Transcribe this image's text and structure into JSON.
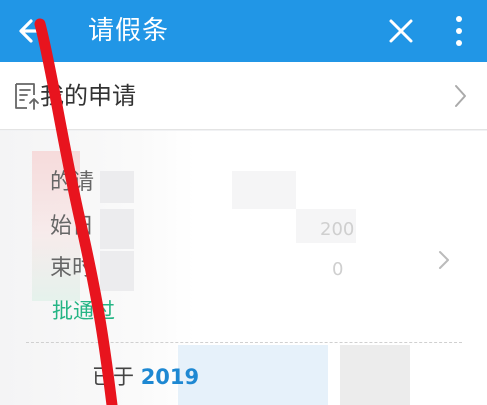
{
  "appbar": {
    "title": "请假条",
    "back_icon": "arrow-left-icon",
    "close_icon": "close-icon",
    "more_icon": "more-vertical-icon",
    "color": "#2196e6"
  },
  "my_applications": {
    "label": "我的申请",
    "icon": "document-upload-icon",
    "chevron_icon": "chevron-right-icon"
  },
  "card": {
    "row1_label": "的请",
    "row2_label": "始日",
    "row3_label": "束时",
    "status": "批通过",
    "status_color": "#25b585",
    "time_fragment_1": "200",
    "time_fragment_2": "0",
    "footer_prefix": "已于",
    "footer_year": "2019",
    "chevron_icon": "chevron-right-icon"
  },
  "overlay_color": "#e8141e"
}
